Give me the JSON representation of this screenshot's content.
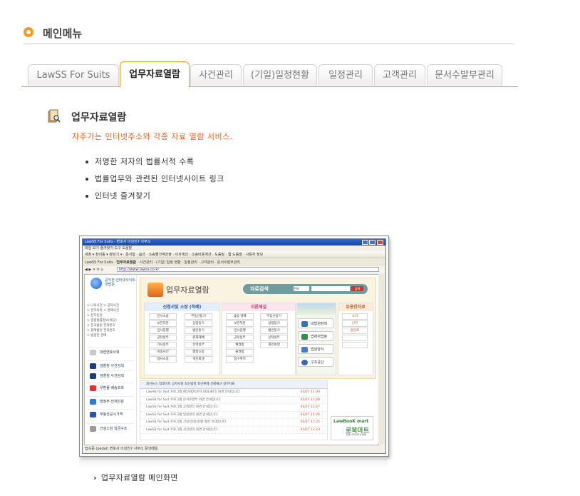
{
  "header": {
    "title": "메인메뉴"
  },
  "tabs": [
    {
      "label": "LawSS For Suits",
      "active": false
    },
    {
      "label": "업무자료열람",
      "active": true
    },
    {
      "label": "사건관리",
      "active": false
    },
    {
      "label": "(기일)일정현황",
      "active": false
    },
    {
      "label": "일정관리",
      "active": false
    },
    {
      "label": "고객관리",
      "active": false
    },
    {
      "label": "문서수발부관리",
      "active": false
    }
  ],
  "section": {
    "title": "업무자료열람",
    "subtitle": "자주가는 인터넷주소와 각종 자료 열람 서비스.",
    "bullets": [
      "저명한 저자의 법률서적 수록",
      "법률업무와 관련된 인터넷사이트 링크",
      "인터넷 즐겨찾기"
    ]
  },
  "screenshot": {
    "window_title": "LawSS For Suits - 변호사 이성진7 사무소",
    "menu": "파일  보기  즐겨찾기  도구  도움말",
    "toolbar": [
      "새창",
      "창이동",
      "창닫기",
      "문서함",
      "옵션",
      "소송물가액산출",
      "이자계산",
      "소송비용계산",
      "도움말",
      "웹 도움말",
      "사용자 정보"
    ],
    "tabs": [
      "LawSS For Suits",
      "업무자료열람",
      "사건관리",
      "(기일) 일정 현황",
      "일정관리",
      "고객관리",
      "문서수발부관리"
    ],
    "url": "http://www.lawss.co.kr",
    "status": "접속중 (pedal) 변호사 이성진7 사무소   문의메일",
    "page": {
      "court": "공익한 인터넷사이트 대법원",
      "left_links": [
        "> 나의사건  > 공탁사건",
        "> 전자독촉  > 경매사건",
        "> 전자민원",
        "> 종합법률정보(예규)",
        "> 전국법원 전화번호",
        "> 판례법원 전화번호",
        "> 법원전 경매"
      ],
      "left_orgs": [
        "대한변호사회",
        "검찰청 사건검색",
        "검찰청 사건검색",
        "우편물 배송조회",
        "행정부 전자민원",
        "부동산공시가격",
        "건설노임  임금구조"
      ],
      "title": "업무자료열람",
      "search_label": "자료검색",
      "search_select": "전체",
      "search_btn": "검색",
      "col1_title": "신청서및 소장 (작례)",
      "col2_title": "이론해설",
      "col4_title": "유용한자료",
      "col1_items": [
        "민사소송",
        "부동산등기",
        "보전처분",
        "상업등기",
        "민사집행",
        "법인등기",
        "공탁실무",
        "준재해배",
        "가사실무",
        "선박실무",
        "비송사건",
        "행정소송",
        "형사소송",
        "개인회생"
      ],
      "col2_items": [
        "금융·경매",
        "부동산등기",
        "보전처분",
        "상업등기",
        "민사집행",
        "법인등기",
        "공탁실무",
        "신탁실무",
        "채권법",
        "개인회생",
        "물권법",
        "청구취지"
      ],
      "col3_buttons": [
        "대법원판례",
        "법제처법령",
        "법원양식",
        "구조공단"
      ],
      "col4_items": [
        "소가",
        "인지",
        "송달료"
      ],
      "news_tabs": "최신뉴스  업데이트  공지사항  최신법령  최신판례  신례예규  실무자료",
      "news_rows": [
        {
          "text": "LawSS for Suit 프로그램 메인화면(문자,대화,폴더) 화면 안내입니다.",
          "date": "03/27  11:30"
        },
        {
          "text": "LawSS for Suit 프로그램 문서수발부 화면 안내입니다.",
          "date": "03/27  11:28"
        },
        {
          "text": "LawSS for Suit 프로그램 고객관리 화면 안내입니다.",
          "date": "03/27  11:27"
        },
        {
          "text": "LawSS for Suit 프로그램 일정관리 화면 안내입니다.",
          "date": "03/27  11:26"
        },
        {
          "text": "LawSS for Suit 프로그램 기일(일정)현황 화면 안내입니다.",
          "date": "03/27  11:25"
        },
        {
          "text": "LawSS for Suit 프로그램 사건관리 화면 안내입니다.",
          "date": "03/27  11:23"
        }
      ],
      "banner_a": "LawBooK mart",
      "banner_b": "로북마트",
      "banner_c": "법률서적전문쇼핑몰"
    }
  },
  "caption": {
    "arrow": "›",
    "text": "업무자료열람 메인화면"
  },
  "colors": {
    "accent": "#e69a2e",
    "subtitle": "#e8601c",
    "dot": "#f39a1e"
  }
}
